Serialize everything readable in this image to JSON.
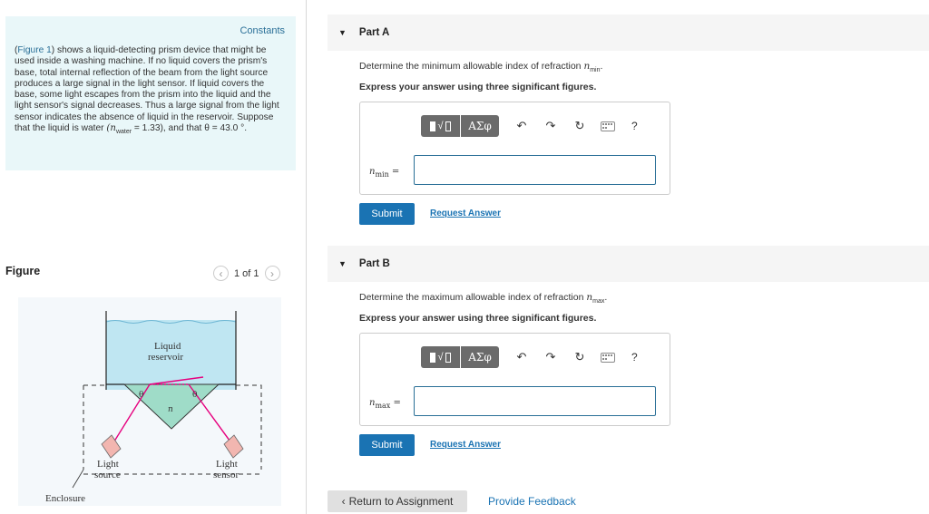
{
  "constants": {
    "title": "Constants",
    "text_before_link": "(",
    "figure_link": "Figure 1",
    "text_after_link": ") shows a liquid-detecting prism device that might be used inside a washing machine. If no liquid covers the prism's base, total internal reflection of the beam from the light source produces a large signal in the light sensor. If liquid covers the base, some light escapes from the prism into the liquid and the light sensor's signal decreases. Thus a large signal from the light sensor indicates the absence of liquid in the reservoir. Suppose that the liquid is water",
    "water_n": "(n",
    "water_sub": "water",
    "water_value": " = 1.33), and that θ = 43.0 °."
  },
  "figure": {
    "label": "Figure",
    "pager": "1 of 1",
    "prev_icon": "chevron-left",
    "next_icon": "chevron-right",
    "diagram": {
      "liquid_label_1": "Liquid",
      "liquid_label_2": "reservoir",
      "theta": "θ",
      "n_label": "n",
      "source_1": "Light",
      "source_2": "source",
      "sensor_1": "Light",
      "sensor_2": "sensor",
      "enclosure": "Enclosure",
      "colors": {
        "liquid": "#bfe6f2",
        "prism": "#9fdcc8",
        "beam": "#e6007e",
        "device": "#f2b6b0"
      }
    }
  },
  "partA": {
    "label": "Part A",
    "question": "Determine the minimum allowable index of refraction",
    "var": "n",
    "var_sub": "min",
    "express": "Express your answer using three significant figures.",
    "input_value": "",
    "submit": "Submit",
    "request": "Request Answer"
  },
  "partB": {
    "label": "Part B",
    "question": "Determine the maximum allowable index of refraction",
    "var": "n",
    "var_sub": "max",
    "express": "Express your answer using three significant figures.",
    "input_value": "",
    "submit": "Submit",
    "request": "Request Answer"
  },
  "toolbar": {
    "greek": "ΑΣφ",
    "icons": [
      "undo-icon",
      "redo-icon",
      "reset-icon",
      "keyboard-icon",
      "help-icon"
    ],
    "help": "?"
  },
  "footer": {
    "return": "Return to Assignment",
    "feedback": "Provide Feedback"
  }
}
